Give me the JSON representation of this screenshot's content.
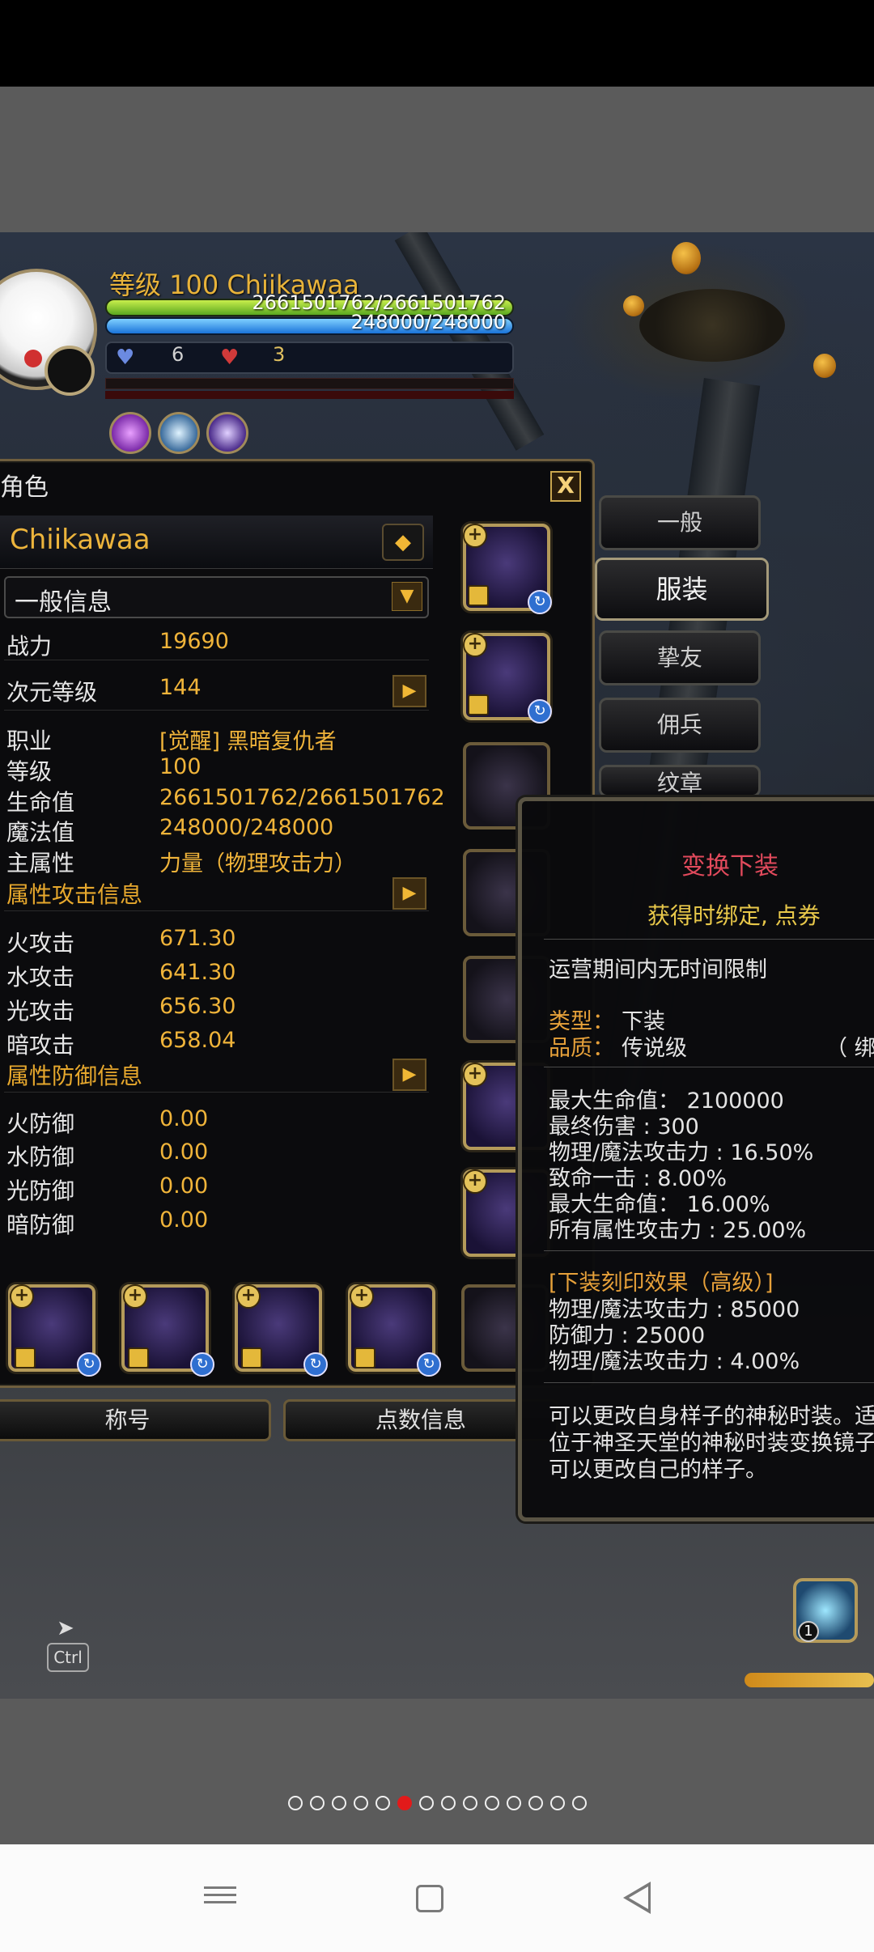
{
  "hud": {
    "level_line": "等级 100 Chiikawaa",
    "hp": "2661501762/2661501762",
    "mp": "248000/248000",
    "buff_blue_count": "6",
    "buff_red_count": "3"
  },
  "window": {
    "title": "角色",
    "close": "X",
    "character_name": "Chiikawaa",
    "name_button": "◆",
    "info_select": "一般信息",
    "stats": [
      {
        "label": "战力",
        "value": "19690"
      },
      {
        "label": "次元等级",
        "value": "144"
      },
      {
        "label": "职业",
        "value": "[觉醒] 黑暗复仇者"
      },
      {
        "label": "等级",
        "value": "100"
      },
      {
        "label": "生命值",
        "value": "2661501762/2661501762"
      },
      {
        "label": "魔法值",
        "value": "248000/248000"
      },
      {
        "label": "主属性",
        "value": "力量（物理攻击力）"
      }
    ],
    "attack_section": "属性攻击信息",
    "attack": [
      {
        "label": "火攻击",
        "value": "671.30"
      },
      {
        "label": "水攻击",
        "value": "641.30"
      },
      {
        "label": "光攻击",
        "value": "656.30"
      },
      {
        "label": "暗攻击",
        "value": "658.04"
      }
    ],
    "defense_section": "属性防御信息",
    "defense": [
      {
        "label": "火防御",
        "value": "0.00"
      },
      {
        "label": "水防御",
        "value": "0.00"
      },
      {
        "label": "光防御",
        "value": "0.00"
      },
      {
        "label": "暗防御",
        "value": "0.00"
      }
    ],
    "bottom_buttons": [
      "称号",
      "点数信息"
    ]
  },
  "side_tabs": [
    "一般",
    "服装",
    "挚友",
    "佣兵",
    "纹章"
  ],
  "tooltip": {
    "title": "变换下装",
    "bind": "获得时绑定, 点券",
    "time_limit": "运营期间内无时间限制",
    "type_label": "类型：",
    "type_value": "下装",
    "quality_label": "品质：",
    "quality_value": "传说级",
    "quality_suffix": "（ 绑",
    "stats": [
      "最大生命值： 2100000",
      "最终伤害 : 300",
      "物理/魔法攻击力 : 16.50%",
      "致命一击 : 8.00%",
      "最大生命值： 16.00%",
      "所有属性攻击力 : 25.00%"
    ],
    "seal_title": "[下装刻印效果（高级）]",
    "seal": [
      "物理/魔法攻击力 : 85000",
      "防御力 : 25000",
      "物理/魔法攻击力 : 4.00%"
    ],
    "description": [
      "可以更改自身样子的神秘时装。适",
      "位于神圣天堂的神秘时装变换镜子",
      "可以更改自己的样子。"
    ]
  },
  "misc": {
    "ctrl_key": "Ctrl",
    "item_count": "1"
  },
  "pager": {
    "total": 14,
    "active_index": 5
  },
  "colors": {
    "accent_gold": "#f0b43a",
    "tooltip_title": "#e24a5c",
    "pager_active": "#e21a1a"
  }
}
